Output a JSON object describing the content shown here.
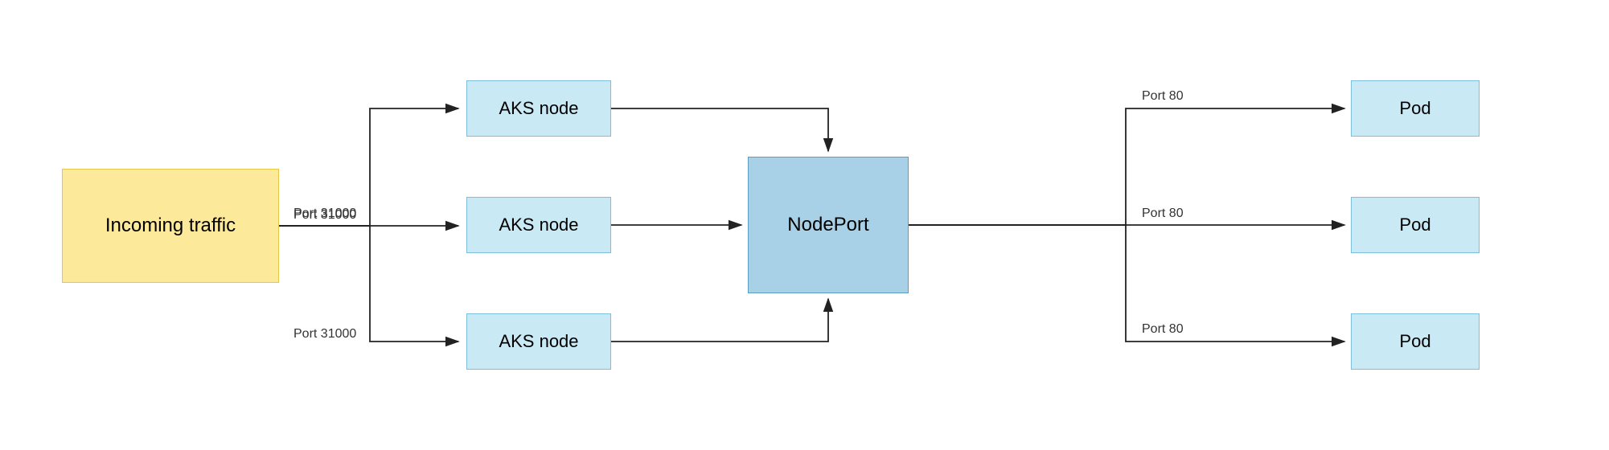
{
  "nodes": {
    "incoming": {
      "label": "Incoming traffic"
    },
    "aks1": {
      "label": "AKS node"
    },
    "aks2": {
      "label": "AKS node"
    },
    "aks3": {
      "label": "AKS node"
    },
    "nodeport": {
      "label": "NodePort"
    },
    "pod1": {
      "label": "Pod"
    },
    "pod2": {
      "label": "Pod"
    },
    "pod3": {
      "label": "Pod"
    }
  },
  "edges": {
    "port31000_label": "Port 31000",
    "port80_label": "Port 80"
  }
}
